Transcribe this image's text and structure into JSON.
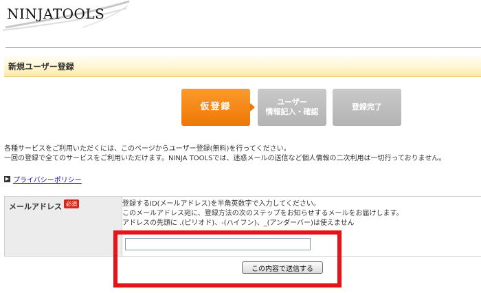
{
  "logo": {
    "text": "NINJATOOLS"
  },
  "page": {
    "title": "新規ユーザー登録"
  },
  "steps": [
    {
      "label": "仮登録",
      "active": true
    },
    {
      "label_line1": "ユーザー",
      "label_line2": "情報記入・確認",
      "active": false
    },
    {
      "label": "登録完了",
      "active": false
    }
  ],
  "intro": {
    "line1": "各種サービスをご利用いただくには、このページからユーザー登録(無料)を行ってください。",
    "line2": "一回の登録で全てのサービスをご利用いただけます。NINJA TOOLSでは、迷惑メールの送信など個人情報の二次利用は一切行っておりません。"
  },
  "privacy_link": {
    "arrow": "▶",
    "text": "プライバシーポリシー"
  },
  "form": {
    "email_label": "メールアドレス",
    "required_badge": "必須",
    "instruction1": "登録するID(メールアドレス)を半角英数字で入力してください。",
    "instruction2": "このメールアドレス宛に、登録方法の次のステップをお知らせするメールをお届けします。",
    "instruction3": "アドレスの先頭に .(ピリオド)、-(ハイフン)、_(アンダーバー)は使えません",
    "email_value": "",
    "submit_label": "この内容で送信する"
  },
  "colors": {
    "accent_orange": "#ee7706",
    "step_inactive": "#b3b3b3",
    "highlight_red": "#e3141a",
    "required_red": "#d9261c"
  }
}
